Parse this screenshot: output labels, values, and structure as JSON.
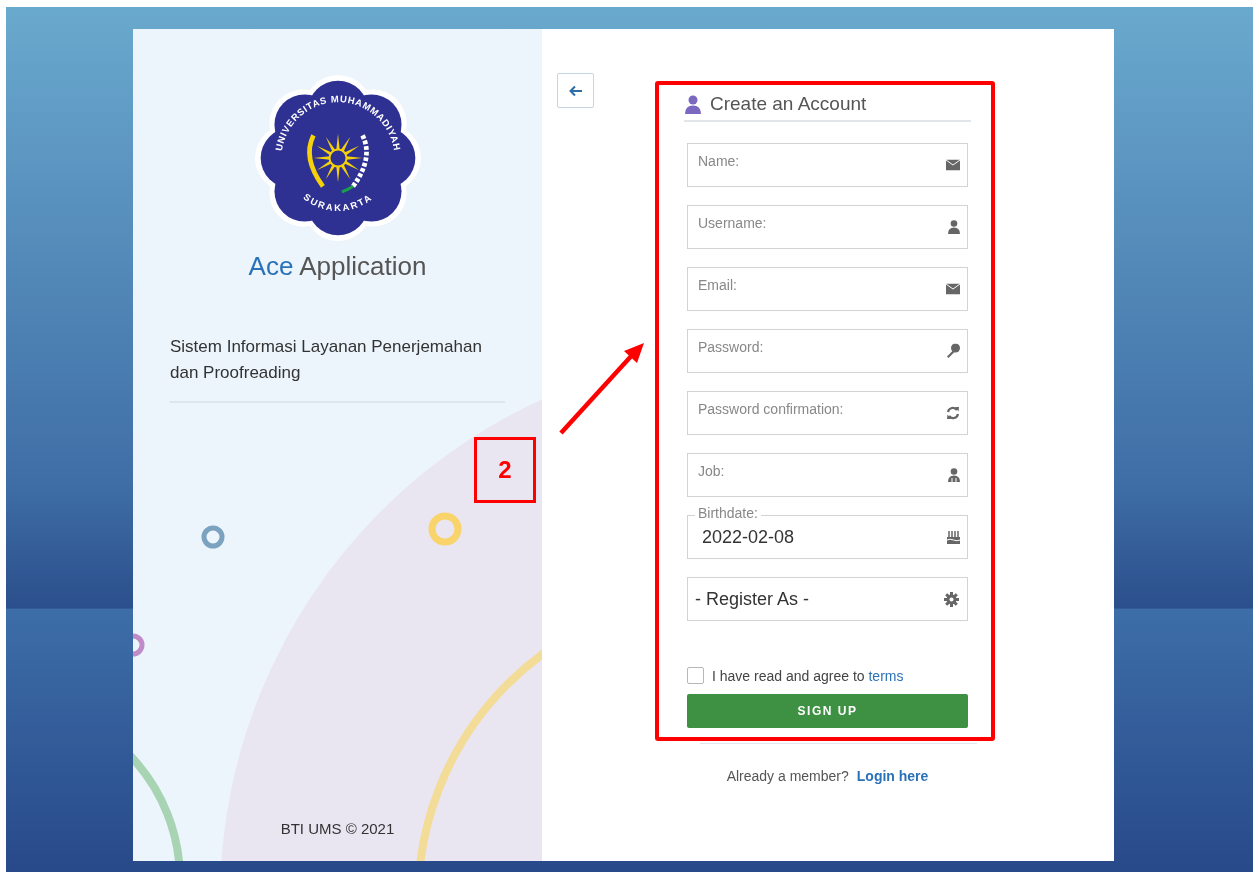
{
  "brand": {
    "logo_top": "UNIVERSITAS MUHAMMADIYAH",
    "logo_bottom": "SURAKARTA",
    "name_accent": "Ace",
    "name_rest": "Application"
  },
  "tagline": "Sistem Informasi Layanan Penerjemahan dan Proofreading",
  "footer": "BTI UMS © 2021",
  "form": {
    "title": "Create an Account",
    "fields": [
      {
        "kind": "text",
        "placeholder": "Name:"
      },
      {
        "kind": "text",
        "placeholder": "Username:"
      },
      {
        "kind": "text",
        "placeholder": "Email:"
      },
      {
        "kind": "text",
        "placeholder": "Password:"
      },
      {
        "kind": "text",
        "placeholder": "Password confirmation:"
      },
      {
        "kind": "text",
        "placeholder": "Job:"
      },
      {
        "kind": "date",
        "label": "Birthdate:",
        "value": "2022-02-08"
      },
      {
        "kind": "select",
        "value": "- Register As -"
      }
    ],
    "agree": {
      "checked": false,
      "text": "I have read and agree to",
      "link": "terms"
    },
    "submit": "SIGN UP",
    "login_prompt": "Already a member?",
    "login_link": "Login here"
  },
  "annotation": {
    "label": "2"
  }
}
